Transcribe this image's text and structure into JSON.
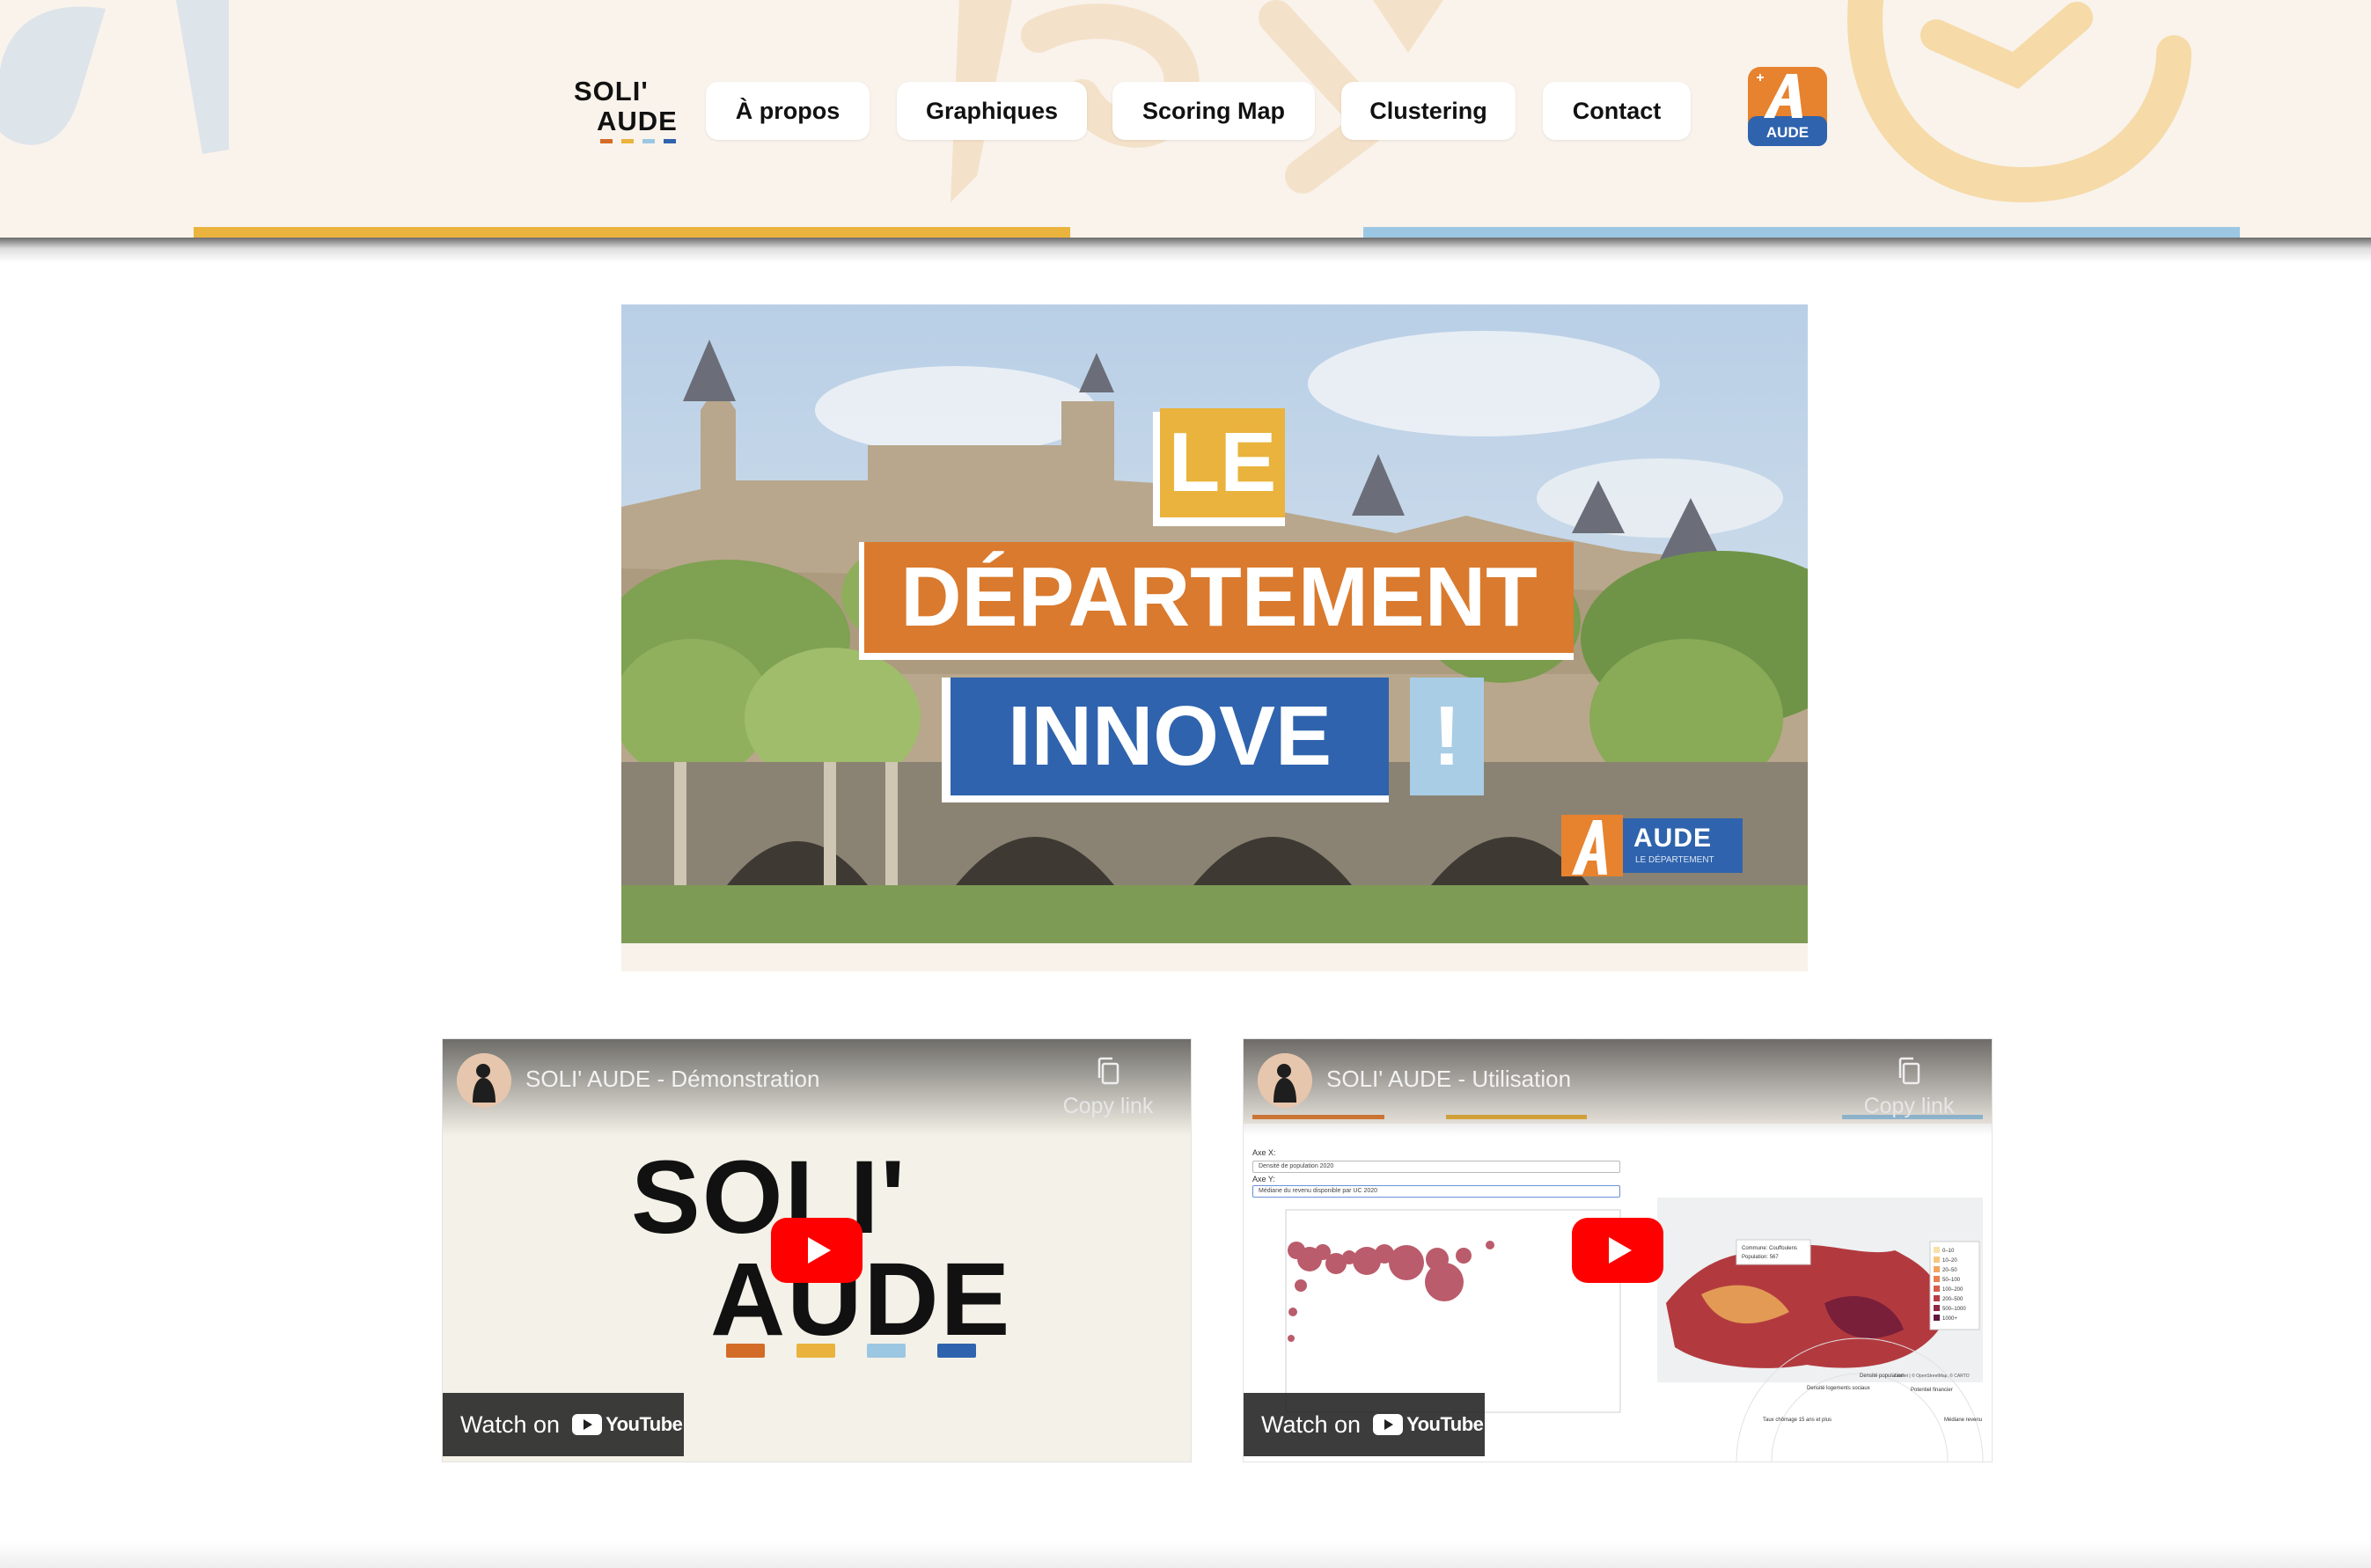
{
  "header": {
    "logo": {
      "line1": "SOLI'",
      "line2": "AUDE"
    },
    "nav": [
      {
        "label": "À propos"
      },
      {
        "label": "Graphiques"
      },
      {
        "label": "Scoring Map"
      },
      {
        "label": "Clustering"
      },
      {
        "label": "Contact"
      }
    ],
    "partner_badge": {
      "word": "AUDE"
    }
  },
  "hero": {
    "line1": "LE",
    "line2": "DÉPARTEMENT",
    "line3": "INNOVE",
    "exclaim": "!",
    "badge_word": "AUDE",
    "badge_sub": "LE DÉPARTEMENT"
  },
  "videos": [
    {
      "title": "SOLI' AUDE - Démonstration",
      "copy_label": "Copy link",
      "watch_label": "Watch on",
      "platform": "YouTube",
      "thumb_text_line1": "SOLI'",
      "thumb_text_line2": "AUDE"
    },
    {
      "title": "SOLI' AUDE - Utilisation",
      "copy_label": "Copy link",
      "watch_label": "Watch on",
      "platform": "YouTube",
      "thumb_labels": {
        "axis_x_label": "Axe X:",
        "axis_x_value": "Densité de population 2020",
        "axis_y_label": "Axe Y:",
        "axis_y_value": "Médiane du revenu disponible par UC 2020",
        "map_tooltip_1": "Commune: Couffoulens",
        "map_tooltip_2": "Population: 567",
        "legend": [
          "0–10",
          "10–20",
          "20–50",
          "50–100",
          "100–200",
          "200–500",
          "500–1000",
          "1000+"
        ],
        "radar_labels": [
          "Densité population",
          "Densité logements sociaux",
          "Potentiel financier",
          "Taux chômage 15 ans et plus",
          "Médiane revenu"
        ],
        "map_attribution": "Leaflet | © OpenStreetMap, © CARTO"
      }
    }
  ],
  "colors": {
    "header_bg": "#f9f3ec",
    "logo_dashes": [
      "#d36c27",
      "#eab33e",
      "#9cc7e3",
      "#2f63ad"
    ],
    "hero_orange": "#d97a2e",
    "hero_yellow": "#eab33e",
    "hero_blue": "#2f63ad",
    "hero_lightblue": "#a9cde5",
    "youtube_red": "#ff0000"
  }
}
